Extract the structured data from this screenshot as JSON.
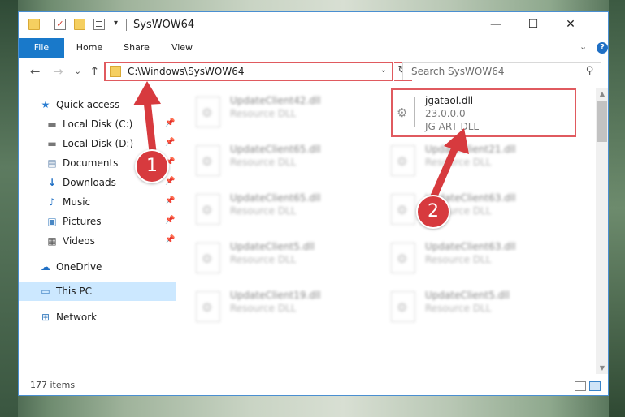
{
  "window": {
    "title": "SysWOW64",
    "minimize": "—",
    "maximize": "☐",
    "close": "✕"
  },
  "quick_access_toolbar": {
    "dropdown": "▾"
  },
  "ribbon": {
    "tabs": [
      {
        "label": "File"
      },
      {
        "label": "Home"
      },
      {
        "label": "Share"
      },
      {
        "label": "View"
      }
    ],
    "collapse": "⌄",
    "help": "?"
  },
  "nav_buttons": {
    "back": "←",
    "forward": "→",
    "recent": "⌄",
    "up": "↑"
  },
  "address_bar": {
    "path": "C:\\Windows\\SysWOW64",
    "dropdown": "⌄",
    "refresh": "↻"
  },
  "search": {
    "placeholder": "Search SysWOW64",
    "icon": "⚲"
  },
  "navigation_pane": {
    "items": [
      {
        "label": "Quick access",
        "icon": "star-icon",
        "pinned": false
      },
      {
        "label": "Local Disk (C:)",
        "icon": "drive-icon",
        "pinned": true
      },
      {
        "label": "Local Disk (D:)",
        "icon": "drive-icon",
        "pinned": true
      },
      {
        "label": "Documents",
        "icon": "documents-icon",
        "pinned": true
      },
      {
        "label": "Downloads",
        "icon": "downloads-icon",
        "pinned": true
      },
      {
        "label": "Music",
        "icon": "music-icon",
        "pinned": true
      },
      {
        "label": "Pictures",
        "icon": "pictures-icon",
        "pinned": true
      },
      {
        "label": "Videos",
        "icon": "videos-icon",
        "pinned": true
      },
      {
        "label": "OneDrive",
        "icon": "onedrive-icon",
        "pinned": false
      },
      {
        "label": "This PC",
        "icon": "this-pc-icon",
        "pinned": false,
        "selected": true
      },
      {
        "label": "Network",
        "icon": "network-icon",
        "pinned": false
      }
    ]
  },
  "files": {
    "left_column": [
      {
        "name": "UpdateClient42.dll",
        "type": "Resource DLL"
      },
      {
        "name": "UpdateClient65.dll",
        "type": "Resource DLL"
      },
      {
        "name": "UpdateClient65.dll",
        "type": "Resource DLL"
      },
      {
        "name": "UpdateClient5.dll",
        "type": "Resource DLL"
      },
      {
        "name": "UpdateClient19.dll",
        "type": "Resource DLL"
      }
    ],
    "right_column": [
      {
        "name": "jgataol.dll",
        "version": "23.0.0.0",
        "type": "JG ART DLL",
        "highlighted": true
      },
      {
        "name": "UpdateClient21.dll",
        "type": "Resource DLL"
      },
      {
        "name": "UpdateClient63.dll",
        "type": "Resource DLL"
      },
      {
        "name": "UpdateClient63.dll",
        "type": "Resource DLL"
      },
      {
        "name": "UpdateClient5.dll",
        "type": "Resource DLL"
      }
    ]
  },
  "status_bar": {
    "item_count": "177 items"
  },
  "annotations": {
    "callout_1": "1",
    "callout_2": "2",
    "color": "#d73a3e"
  },
  "colors": {
    "accent": "#1979ca",
    "highlight_border": "#e05a5f",
    "selection": "#cce8ff"
  }
}
